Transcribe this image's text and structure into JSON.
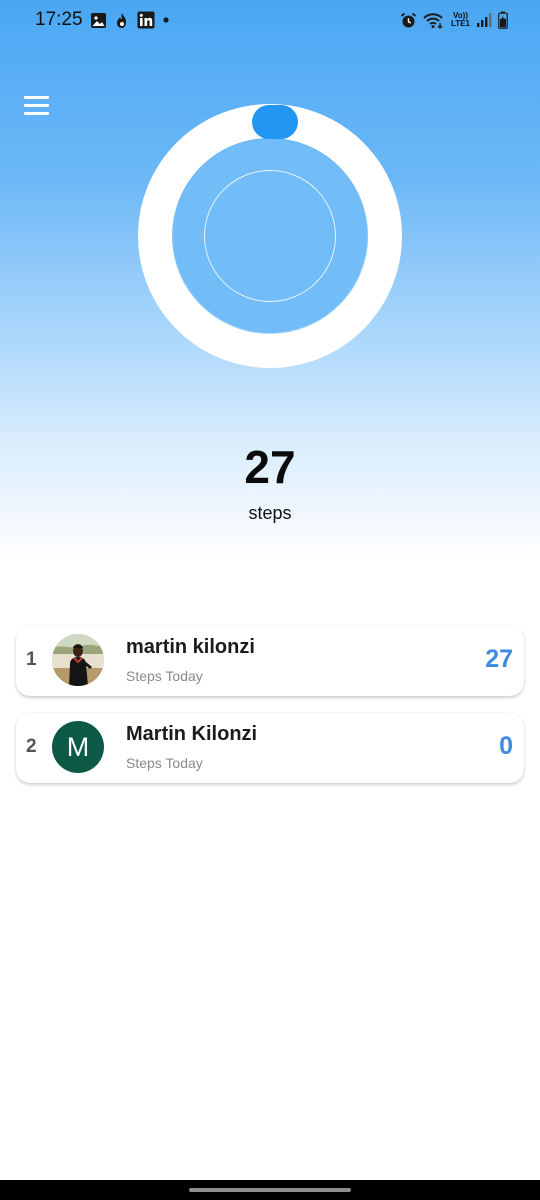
{
  "status_bar": {
    "time": "17:25",
    "left_icons": [
      "image-icon",
      "fire-icon",
      "linkedin-icon",
      "dot-icon"
    ],
    "right_icons": [
      "alarm-icon",
      "wifi-icon",
      "volte-icon",
      "signal-icon",
      "battery-icon"
    ],
    "lte_line1": "Vo))",
    "lte_line2": "LTE1"
  },
  "menu": {
    "icon": "hamburger-menu-icon"
  },
  "progress": {
    "steps": "27",
    "unit": "steps",
    "ring_color": "#ffffff",
    "indicator_color": "#2196f3"
  },
  "leaderboard": [
    {
      "rank": "1",
      "name": "martin kilonzi",
      "subtitle": "Steps Today",
      "steps": "27",
      "avatar": "photo"
    },
    {
      "rank": "2",
      "name": "Martin Kilonzi",
      "subtitle": "Steps Today",
      "steps": "0",
      "avatar_letter": "M",
      "avatar_color": "#0c5a45"
    }
  ],
  "colors": {
    "accent": "#3d8ae0",
    "header_gradient_top": "#4aa7f3"
  }
}
